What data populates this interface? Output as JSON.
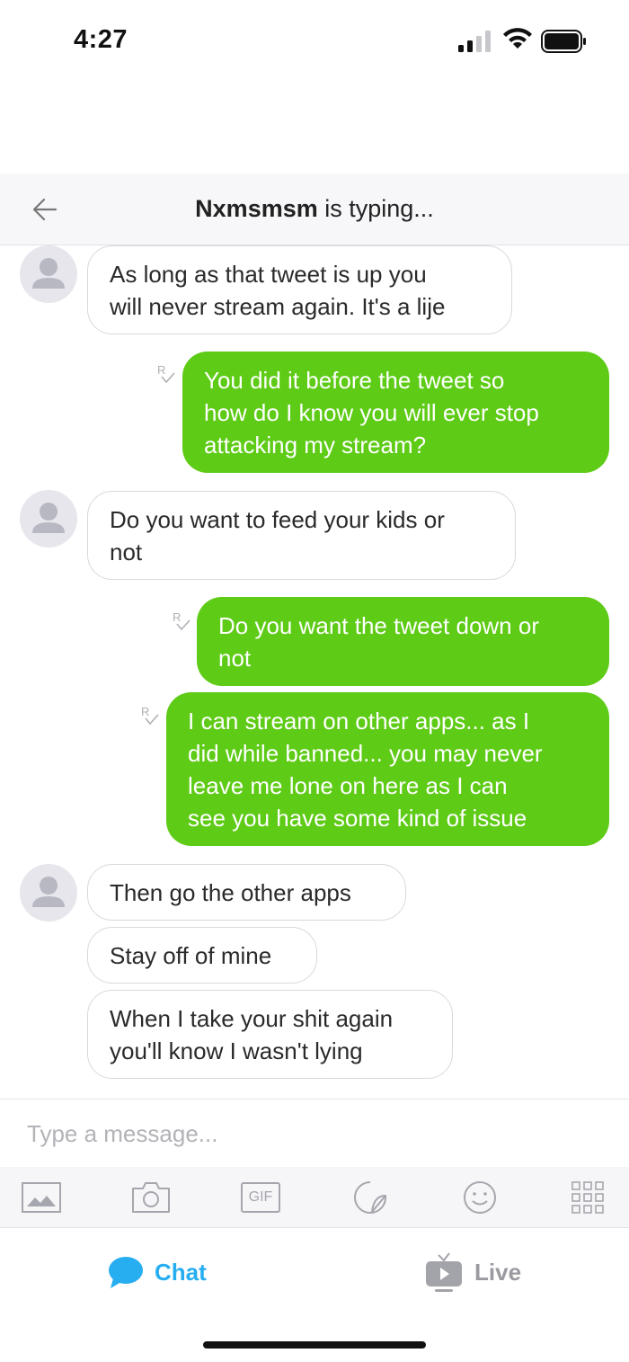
{
  "status_bar": {
    "time": "4:27"
  },
  "header": {
    "contact_name": "Nxmsmsm",
    "status_suffix": " is typing..."
  },
  "messages": [
    {
      "direction": "incoming",
      "lines": [
        "As long as that tweet is up you",
        "will never stream again. It's a lije"
      ]
    },
    {
      "direction": "outgoing",
      "lines": [
        "You did it before the tweet so",
        "how do I know you will ever stop",
        "attacking my stream?"
      ]
    },
    {
      "direction": "incoming",
      "lines": [
        "Do you want to feed your kids or",
        "not"
      ]
    },
    {
      "direction": "outgoing",
      "lines": [
        "Do you want the tweet down or",
        "not"
      ]
    },
    {
      "direction": "outgoing",
      "lines": [
        "I can stream on other apps... as I",
        "did while banned... you may never",
        "leave me lone on here as I can",
        "see you have some kind of issue"
      ]
    },
    {
      "direction": "incoming",
      "lines": [
        "Then go the other apps"
      ]
    },
    {
      "direction": "incoming",
      "lines": [
        "Stay off of mine"
      ]
    },
    {
      "direction": "incoming",
      "lines": [
        "When I take your shit again",
        "you'll know I wasn't lying"
      ]
    }
  ],
  "input": {
    "placeholder": "Type a message..."
  },
  "toolbar": {
    "gif_label": "GIF",
    "icons": [
      "image-icon",
      "camera-icon",
      "gif-icon",
      "sticker-icon",
      "emoji-icon",
      "more-grid-icon"
    ]
  },
  "tabs": {
    "chat_label": "Chat",
    "live_label": "Live"
  },
  "colors": {
    "outgoing_bubble": "#5ecb16",
    "accent": "#27aef0",
    "incoming_border": "#d9d9dd"
  }
}
